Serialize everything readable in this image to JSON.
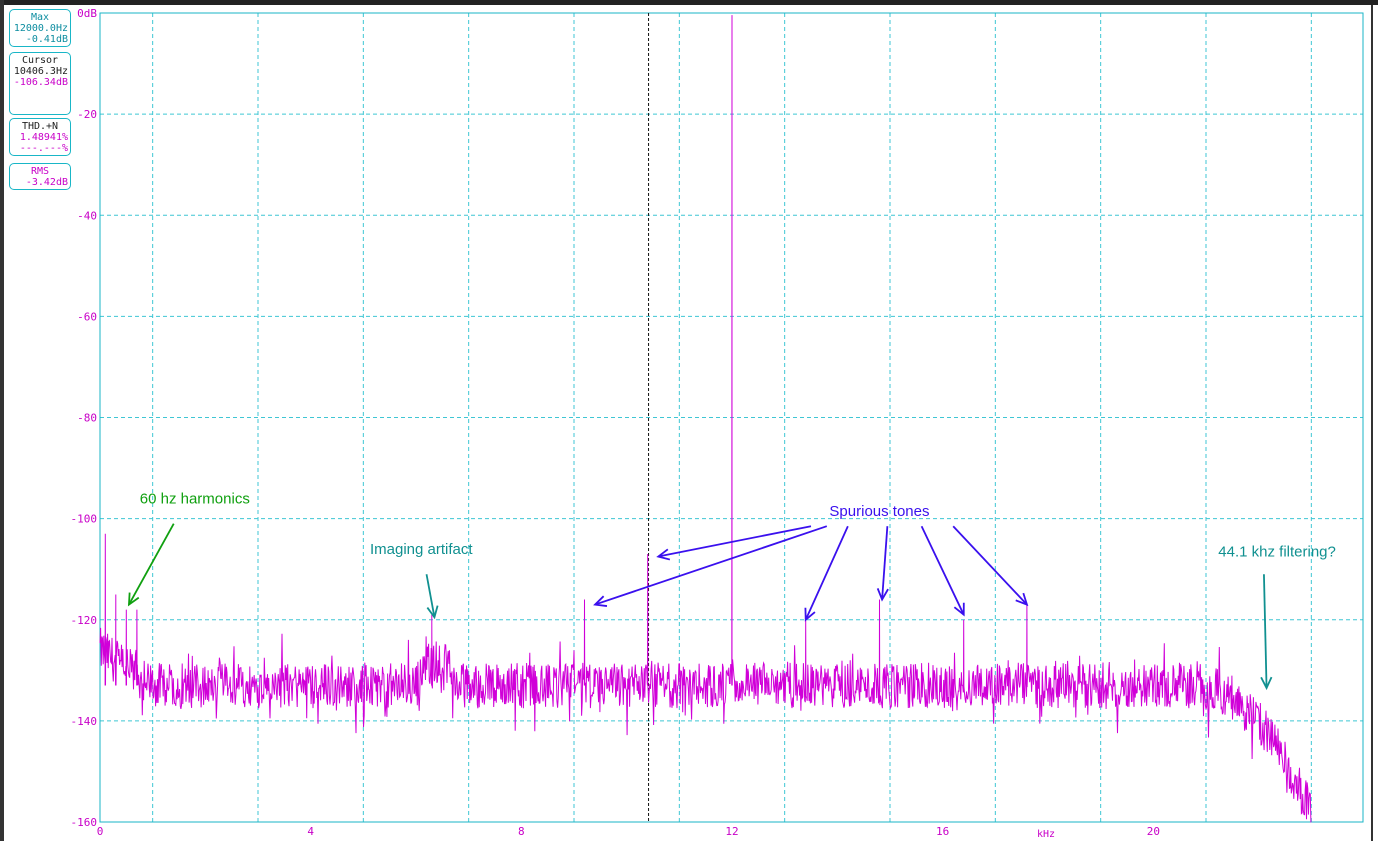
{
  "readouts": {
    "max": {
      "title": "Max",
      "freq": "12000.0Hz",
      "level": "-0.41dB"
    },
    "cursor": {
      "title": "Cursor",
      "freq": "10406.3Hz",
      "level": "-106.34dB"
    },
    "thd": {
      "title": "THD.+N",
      "value1": "1.48941%",
      "value2": "---.---%"
    },
    "rms": {
      "title": "RMS",
      "value": "-3.42dB"
    }
  },
  "chart_data": {
    "type": "line",
    "xlabel": "kHz",
    "ylabel": "",
    "xlim": [
      0,
      23.5
    ],
    "ylim": [
      -160,
      0
    ],
    "x_ticks": [
      "0",
      "4",
      "8",
      "12",
      "16",
      "20"
    ],
    "x_tick_values": [
      0,
      4,
      8,
      12,
      16,
      20
    ],
    "y_ticks": [
      "0dB",
      "-20",
      "-40",
      "-60",
      "-80",
      "-100",
      "-120",
      "-140",
      "-160"
    ],
    "y_tick_values": [
      0,
      -20,
      -40,
      -60,
      -80,
      -100,
      -120,
      -140,
      -160
    ],
    "grid": true,
    "cursor_x": 10.406,
    "series": [
      {
        "color": "#d000d8",
        "noise_floor": -133,
        "peaks": [
          {
            "x": 0.1,
            "y": -103
          },
          {
            "x": 0.3,
            "y": -115
          },
          {
            "x": 0.5,
            "y": -118
          },
          {
            "x": 0.7,
            "y": -118
          },
          {
            "x": 6.3,
            "y": -119
          },
          {
            "x": 9.2,
            "y": -116
          },
          {
            "x": 10.4,
            "y": -107
          },
          {
            "x": 12.0,
            "y": -0.41
          },
          {
            "x": 13.4,
            "y": -120
          },
          {
            "x": 14.8,
            "y": -116
          },
          {
            "x": 16.4,
            "y": -120
          },
          {
            "x": 17.6,
            "y": -117
          }
        ],
        "rolloff_start": 20.8,
        "end": 23.0
      }
    ],
    "annotations": [
      {
        "text": "60 hz harmonics",
        "color": "#10a010",
        "text_x": 1.8,
        "text_y": -97,
        "arrows": [
          [
            1.4,
            -101,
            0.55,
            -117
          ]
        ]
      },
      {
        "text": "Imaging artifact",
        "color": "#109090",
        "text_x": 6.1,
        "text_y": -107,
        "arrows": [
          [
            6.2,
            -111,
            6.35,
            -119.5
          ]
        ]
      },
      {
        "text": "Spurious tones",
        "color": "#3a10ee",
        "text_x": 14.8,
        "text_y": -99.5,
        "arrows": [
          [
            13.5,
            -101.5,
            10.6,
            -107.5
          ],
          [
            13.8,
            -101.5,
            9.4,
            -117
          ],
          [
            14.2,
            -101.5,
            13.4,
            -120
          ],
          [
            14.95,
            -101.5,
            14.85,
            -116
          ],
          [
            15.6,
            -101.5,
            16.4,
            -119
          ],
          [
            16.2,
            -101.5,
            17.6,
            -117
          ]
        ]
      },
      {
        "text": "44.1 khz filtering?",
        "color": "#109090",
        "text_x": 22.35,
        "text_y": -107.5,
        "arrows": [
          [
            22.1,
            -111,
            22.15,
            -133.5
          ]
        ]
      }
    ]
  }
}
